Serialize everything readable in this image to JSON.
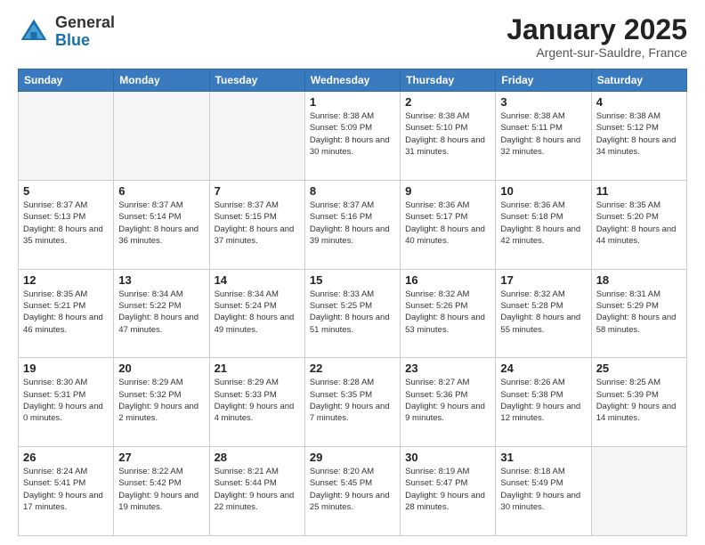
{
  "header": {
    "logo_general": "General",
    "logo_blue": "Blue",
    "month_title": "January 2025",
    "subtitle": "Argent-sur-Sauldre, France"
  },
  "days_of_week": [
    "Sunday",
    "Monday",
    "Tuesday",
    "Wednesday",
    "Thursday",
    "Friday",
    "Saturday"
  ],
  "weeks": [
    [
      {
        "day": "",
        "empty": true
      },
      {
        "day": "",
        "empty": true
      },
      {
        "day": "",
        "empty": true
      },
      {
        "day": "1",
        "sunrise": "8:38 AM",
        "sunset": "5:09 PM",
        "daylight": "8 hours and 30 minutes."
      },
      {
        "day": "2",
        "sunrise": "8:38 AM",
        "sunset": "5:10 PM",
        "daylight": "8 hours and 31 minutes."
      },
      {
        "day": "3",
        "sunrise": "8:38 AM",
        "sunset": "5:11 PM",
        "daylight": "8 hours and 32 minutes."
      },
      {
        "day": "4",
        "sunrise": "8:38 AM",
        "sunset": "5:12 PM",
        "daylight": "8 hours and 34 minutes."
      }
    ],
    [
      {
        "day": "5",
        "sunrise": "8:37 AM",
        "sunset": "5:13 PM",
        "daylight": "8 hours and 35 minutes."
      },
      {
        "day": "6",
        "sunrise": "8:37 AM",
        "sunset": "5:14 PM",
        "daylight": "8 hours and 36 minutes."
      },
      {
        "day": "7",
        "sunrise": "8:37 AM",
        "sunset": "5:15 PM",
        "daylight": "8 hours and 37 minutes."
      },
      {
        "day": "8",
        "sunrise": "8:37 AM",
        "sunset": "5:16 PM",
        "daylight": "8 hours and 39 minutes."
      },
      {
        "day": "9",
        "sunrise": "8:36 AM",
        "sunset": "5:17 PM",
        "daylight": "8 hours and 40 minutes."
      },
      {
        "day": "10",
        "sunrise": "8:36 AM",
        "sunset": "5:18 PM",
        "daylight": "8 hours and 42 minutes."
      },
      {
        "day": "11",
        "sunrise": "8:35 AM",
        "sunset": "5:20 PM",
        "daylight": "8 hours and 44 minutes."
      }
    ],
    [
      {
        "day": "12",
        "sunrise": "8:35 AM",
        "sunset": "5:21 PM",
        "daylight": "8 hours and 46 minutes."
      },
      {
        "day": "13",
        "sunrise": "8:34 AM",
        "sunset": "5:22 PM",
        "daylight": "8 hours and 47 minutes."
      },
      {
        "day": "14",
        "sunrise": "8:34 AM",
        "sunset": "5:24 PM",
        "daylight": "8 hours and 49 minutes."
      },
      {
        "day": "15",
        "sunrise": "8:33 AM",
        "sunset": "5:25 PM",
        "daylight": "8 hours and 51 minutes."
      },
      {
        "day": "16",
        "sunrise": "8:32 AM",
        "sunset": "5:26 PM",
        "daylight": "8 hours and 53 minutes."
      },
      {
        "day": "17",
        "sunrise": "8:32 AM",
        "sunset": "5:28 PM",
        "daylight": "8 hours and 55 minutes."
      },
      {
        "day": "18",
        "sunrise": "8:31 AM",
        "sunset": "5:29 PM",
        "daylight": "8 hours and 58 minutes."
      }
    ],
    [
      {
        "day": "19",
        "sunrise": "8:30 AM",
        "sunset": "5:31 PM",
        "daylight": "9 hours and 0 minutes."
      },
      {
        "day": "20",
        "sunrise": "8:29 AM",
        "sunset": "5:32 PM",
        "daylight": "9 hours and 2 minutes."
      },
      {
        "day": "21",
        "sunrise": "8:29 AM",
        "sunset": "5:33 PM",
        "daylight": "9 hours and 4 minutes."
      },
      {
        "day": "22",
        "sunrise": "8:28 AM",
        "sunset": "5:35 PM",
        "daylight": "9 hours and 7 minutes."
      },
      {
        "day": "23",
        "sunrise": "8:27 AM",
        "sunset": "5:36 PM",
        "daylight": "9 hours and 9 minutes."
      },
      {
        "day": "24",
        "sunrise": "8:26 AM",
        "sunset": "5:38 PM",
        "daylight": "9 hours and 12 minutes."
      },
      {
        "day": "25",
        "sunrise": "8:25 AM",
        "sunset": "5:39 PM",
        "daylight": "9 hours and 14 minutes."
      }
    ],
    [
      {
        "day": "26",
        "sunrise": "8:24 AM",
        "sunset": "5:41 PM",
        "daylight": "9 hours and 17 minutes."
      },
      {
        "day": "27",
        "sunrise": "8:22 AM",
        "sunset": "5:42 PM",
        "daylight": "9 hours and 19 minutes."
      },
      {
        "day": "28",
        "sunrise": "8:21 AM",
        "sunset": "5:44 PM",
        "daylight": "9 hours and 22 minutes."
      },
      {
        "day": "29",
        "sunrise": "8:20 AM",
        "sunset": "5:45 PM",
        "daylight": "9 hours and 25 minutes."
      },
      {
        "day": "30",
        "sunrise": "8:19 AM",
        "sunset": "5:47 PM",
        "daylight": "9 hours and 28 minutes."
      },
      {
        "day": "31",
        "sunrise": "8:18 AM",
        "sunset": "5:49 PM",
        "daylight": "9 hours and 30 minutes."
      },
      {
        "day": "",
        "empty": true
      }
    ]
  ]
}
